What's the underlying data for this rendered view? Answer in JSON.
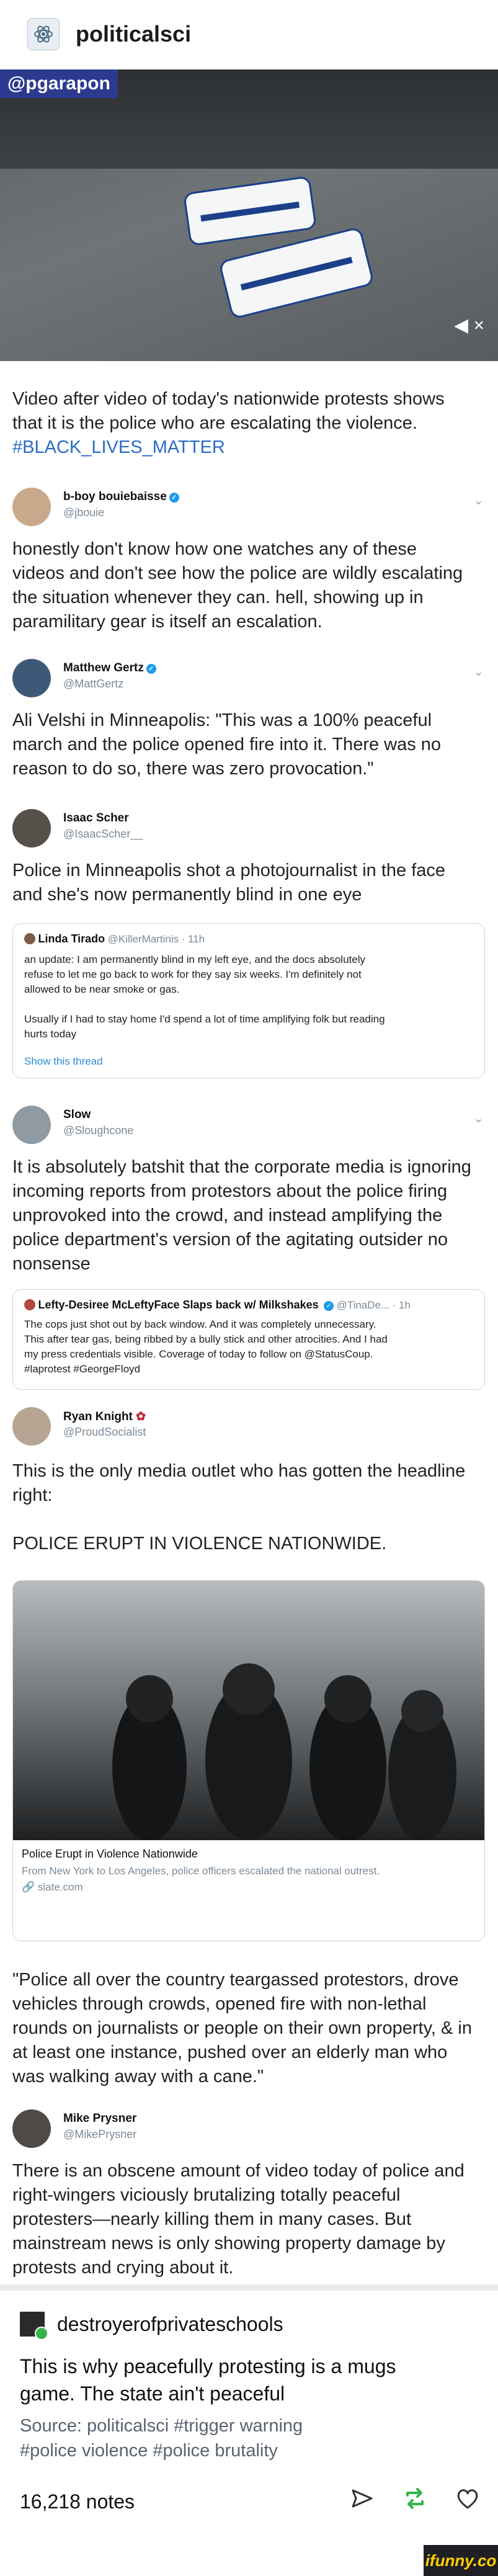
{
  "post": {
    "author": "politicalsci",
    "video_handle": "@pgarapon",
    "caption_line1": "Video after video of today's nationwide protests shows",
    "caption_line2": "that it is the police who are escalating the violence.",
    "caption_hashtag": "#BLACK_LIVES_MATTER"
  },
  "tweets": [
    {
      "name": "b-boy bouiebaisse",
      "handle": "@jbouie",
      "lines": [
        "honestly don't know how one watches any of these",
        "videos and don't see how the police are wildly escalating",
        "the situation whenever they can. hell, showing up in",
        "paramilitary gear is itself an escalation."
      ]
    },
    {
      "name": "Matthew Gertz",
      "handle": "@MattGertz",
      "lines": [
        "Ali Velshi in Minneapolis: \"This was a 100% peaceful",
        "march and the police opened fire into it. There was no",
        "reason to do so, there was zero provocation.\""
      ]
    },
    {
      "name": "Isaac Scher",
      "handle": "@IsaacScher__",
      "lines": [
        "Police in Minneapolis shot a photojournalist in the face",
        "and she's now permanently blind in one eye"
      ],
      "quote": {
        "name": "Linda Tirado",
        "handle": "@KillerMartinis",
        "time": "· 11h",
        "lines": [
          "an update: I am permanently blind in my left eye, and the docs absolutely",
          "refuse to let me go back to work for they say six weeks. I'm definitely not",
          "allowed to be near smoke or gas.",
          "",
          "Usually if I had to stay home I'd spend a lot of time amplifying folk but reading",
          "hurts today"
        ],
        "link": "Show this thread"
      }
    },
    {
      "name": "Slow",
      "handle": "@Sloughcone",
      "lines": [
        "It is absolutely batshit that the corporate media is ignoring",
        "incoming reports from protestors about the police firing",
        "unprovoked into the crowd, and instead amplifying the",
        "police department's version of the agitating outsider no",
        "nonsense"
      ],
      "quote": {
        "name": "Lefty-Desiree McLeftyFace Slaps back w/ Milkshakes",
        "handle": "@TinaDe...",
        "time": "· 1h",
        "lines": [
          "The cops just shot out by back window. And it was completely unnecessary.",
          "This after tear gas, being ribbed by a bully stick and other atrocities. And I had",
          "my press credentials visible. Coverage of today to follow on @StatusCoup.",
          "#laprotest #GeorgeFloyd"
        ]
      }
    },
    {
      "name": "Ryan Knight",
      "handle": "@ProudSocialist",
      "lines": [
        "This is the only media outlet who has gotten the headline",
        "right:",
        "",
        "POLICE ERUPT IN VIOLENCE NATIONWIDE."
      ],
      "card": {
        "caption": "Police Erupt in Violence Nationwide",
        "description": "From New York to Los Angeles, police officers escalated the national outrest.",
        "site": "slate.com"
      },
      "after_lines": [
        "\"Police all over the country teargassed protestors, drove",
        "vehicles through crowds, opened fire with non-lethal",
        "rounds on journalists or people on their own property, & in",
        "at least one instance, pushed over an elderly man who",
        "was walking away with a cane.\""
      ]
    },
    {
      "name": "Mike Prysner",
      "handle": "@MikePrysner",
      "lines": [
        "There is an obscene amount of video today of police and",
        "right-wingers viciously brutalizing totally peaceful",
        "protesters—nearly killing them in many cases. But",
        "mainstream news is only showing property damage by",
        "protests and crying about it."
      ]
    }
  ],
  "reblog": {
    "author": "destroyerofprivateschools",
    "text_line1": "This is why peacefully protesting is a mugs",
    "text_line2": "game. The state ain't peaceful",
    "tags_line1": "Source: politicalsci    #trigger warning",
    "tags_line2": "#police violence   #police brutality"
  },
  "footer": {
    "notes": "16,218 notes",
    "watermark": "ifunny.co"
  },
  "icons": {
    "share": "send-icon",
    "reblog": "reblog-icon",
    "like": "heart-icon"
  },
  "colors": {
    "hashtag": "#2a6cc7",
    "reblog_green": "#36b34a",
    "police_blue": "#1c3f8a"
  }
}
